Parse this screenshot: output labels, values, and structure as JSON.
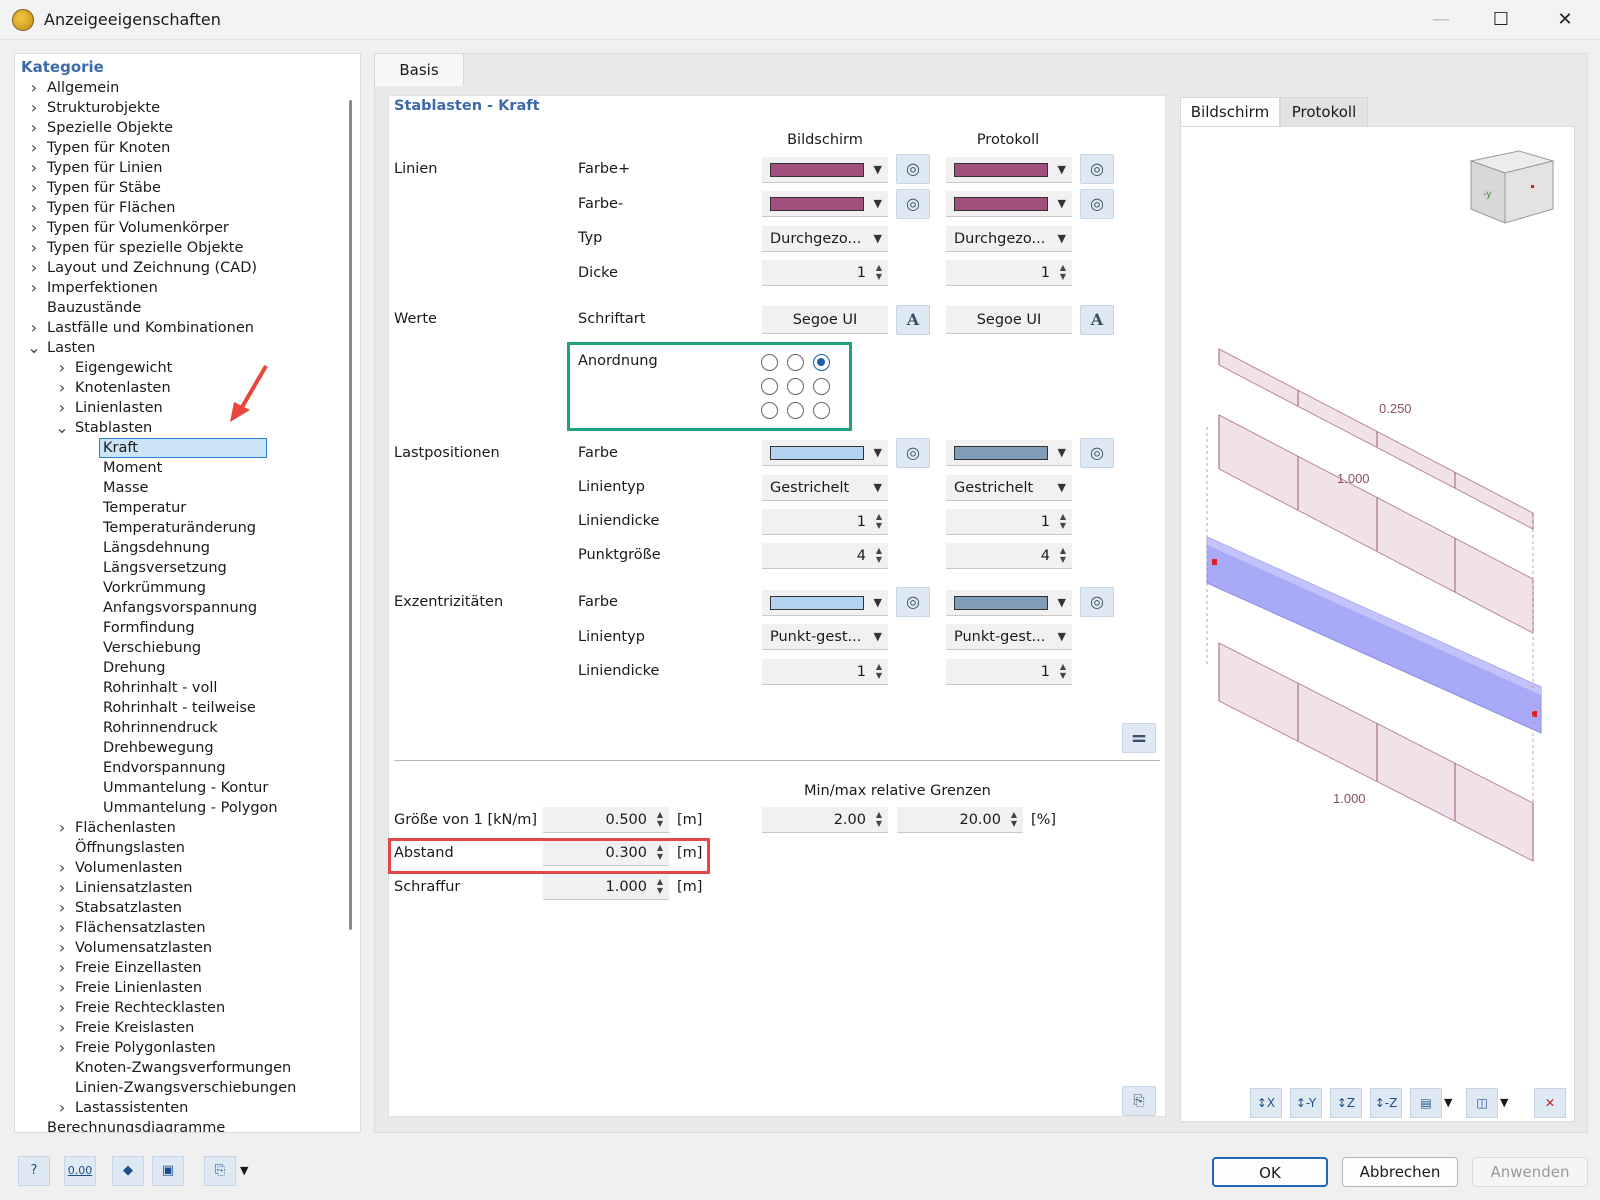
{
  "window": {
    "title": "Anzeigeeigenschaften"
  },
  "tree": {
    "header": "Kategorie",
    "items": [
      {
        "label": "Allgemein",
        "level": 0,
        "chev": ">"
      },
      {
        "label": "Strukturobjekte",
        "level": 0,
        "chev": ">"
      },
      {
        "label": "Spezielle Objekte",
        "level": 0,
        "chev": ">"
      },
      {
        "label": "Typen für Knoten",
        "level": 0,
        "chev": ">"
      },
      {
        "label": "Typen für Linien",
        "level": 0,
        "chev": ">"
      },
      {
        "label": "Typen für Stäbe",
        "level": 0,
        "chev": ">"
      },
      {
        "label": "Typen für Flächen",
        "level": 0,
        "chev": ">"
      },
      {
        "label": "Typen für Volumenkörper",
        "level": 0,
        "chev": ">"
      },
      {
        "label": "Typen für spezielle Objekte",
        "level": 0,
        "chev": ">"
      },
      {
        "label": "Layout und Zeichnung (CAD)",
        "level": 0,
        "chev": ">"
      },
      {
        "label": "Imperfektionen",
        "level": 0,
        "chev": ">"
      },
      {
        "label": "Bauzustände",
        "level": 0,
        "chev": ""
      },
      {
        "label": "Lastfälle und Kombinationen",
        "level": 0,
        "chev": ">"
      },
      {
        "label": "Lasten",
        "level": 0,
        "chev": "v"
      },
      {
        "label": "Eigengewicht",
        "level": 1,
        "chev": ">"
      },
      {
        "label": "Knotenlasten",
        "level": 1,
        "chev": ">"
      },
      {
        "label": "Linienlasten",
        "level": 1,
        "chev": ">"
      },
      {
        "label": "Stablasten",
        "level": 1,
        "chev": "v"
      },
      {
        "label": "Kraft",
        "level": 2,
        "chev": "",
        "selected": true
      },
      {
        "label": "Moment",
        "level": 2,
        "chev": ""
      },
      {
        "label": "Masse",
        "level": 2,
        "chev": ""
      },
      {
        "label": "Temperatur",
        "level": 2,
        "chev": ""
      },
      {
        "label": "Temperaturänderung",
        "level": 2,
        "chev": ""
      },
      {
        "label": "Längsdehnung",
        "level": 2,
        "chev": ""
      },
      {
        "label": "Längsversetzung",
        "level": 2,
        "chev": ""
      },
      {
        "label": "Vorkrümmung",
        "level": 2,
        "chev": ""
      },
      {
        "label": "Anfangsvorspannung",
        "level": 2,
        "chev": ""
      },
      {
        "label": "Formfindung",
        "level": 2,
        "chev": ""
      },
      {
        "label": "Verschiebung",
        "level": 2,
        "chev": ""
      },
      {
        "label": "Drehung",
        "level": 2,
        "chev": ""
      },
      {
        "label": "Rohrinhalt - voll",
        "level": 2,
        "chev": ""
      },
      {
        "label": "Rohrinhalt - teilweise",
        "level": 2,
        "chev": ""
      },
      {
        "label": "Rohrinnendruck",
        "level": 2,
        "chev": ""
      },
      {
        "label": "Drehbewegung",
        "level": 2,
        "chev": ""
      },
      {
        "label": "Endvorspannung",
        "level": 2,
        "chev": ""
      },
      {
        "label": "Ummantelung - Kontur",
        "level": 2,
        "chev": ""
      },
      {
        "label": "Ummantelung - Polygon",
        "level": 2,
        "chev": ""
      },
      {
        "label": "Flächenlasten",
        "level": 1,
        "chev": ">"
      },
      {
        "label": "Öffnungslasten",
        "level": 1,
        "chev": ""
      },
      {
        "label": "Volumenlasten",
        "level": 1,
        "chev": ">"
      },
      {
        "label": "Liniensatzlasten",
        "level": 1,
        "chev": ">"
      },
      {
        "label": "Stabsatzlasten",
        "level": 1,
        "chev": ">"
      },
      {
        "label": "Flächensatzlasten",
        "level": 1,
        "chev": ">"
      },
      {
        "label": "Volumensatzlasten",
        "level": 1,
        "chev": ">"
      },
      {
        "label": "Freie Einzellasten",
        "level": 1,
        "chev": ">"
      },
      {
        "label": "Freie Linienlasten",
        "level": 1,
        "chev": ">"
      },
      {
        "label": "Freie Rechtecklasten",
        "level": 1,
        "chev": ">"
      },
      {
        "label": "Freie Kreislasten",
        "level": 1,
        "chev": ">"
      },
      {
        "label": "Freie Polygonlasten",
        "level": 1,
        "chev": ">"
      },
      {
        "label": "Knoten-Zwangsverformungen",
        "level": 1,
        "chev": ""
      },
      {
        "label": "Linien-Zwangsverschiebungen",
        "level": 1,
        "chev": ""
      },
      {
        "label": "Lastassistenten",
        "level": 1,
        "chev": ">"
      },
      {
        "label": "Berechnungsdiagramme",
        "level": 0,
        "chev": ""
      }
    ]
  },
  "main": {
    "tab": "Basis",
    "section_title": "Stablasten - Kraft",
    "col_screen": "Bildschirm",
    "col_protocol": "Protokoll",
    "linien": {
      "group": "Linien",
      "farbe_plus": "Farbe+",
      "farbe_minus": "Farbe-",
      "typ": "Typ",
      "typ_screen": "Durchgezo...",
      "typ_protocol": "Durchgezo...",
      "dicke": "Dicke",
      "dicke_screen": "1",
      "dicke_protocol": "1",
      "color_plus": "#a34f7e",
      "color_minus": "#a34f7e"
    },
    "werte": {
      "group": "Werte",
      "schriftart": "Schriftart",
      "font_screen": "Segoe UI",
      "font_protocol": "Segoe UI",
      "anordnung": "Anordnung"
    },
    "lastpositionen": {
      "group": "Lastpositionen",
      "farbe": "Farbe",
      "linientyp": "Linientyp",
      "linientyp_screen": "Gestrichelt",
      "linientyp_protocol": "Gestrichelt",
      "liniendicke": "Liniendicke",
      "liniendicke_screen": "1",
      "liniendicke_protocol": "1",
      "punktgroesse": "Punktgröße",
      "punkt_screen": "4",
      "punkt_protocol": "4",
      "color_screen": "#b3d3f2",
      "color_protocol": "#7f9cb8"
    },
    "exzentrizitaeten": {
      "group": "Exzentrizitäten",
      "farbe": "Farbe",
      "linientyp": "Linientyp",
      "linientyp_screen": "Punkt-gest...",
      "linientyp_protocol": "Punkt-gest...",
      "liniendicke": "Liniendicke",
      "liniendicke_screen": "1",
      "liniendicke_protocol": "1",
      "color_screen": "#b3d3f2",
      "color_protocol": "#7f9cb8"
    },
    "bottom": {
      "minmax_label": "Min/max relative Grenzen",
      "groesse_label": "Größe von 1 [kN/m]",
      "groesse_value": "0.500",
      "groesse_unit": "[m]",
      "min_value": "2.00",
      "max_value": "20.00",
      "percent_unit": "[%]",
      "abstand_label": "Abstand",
      "abstand_value": "0.300",
      "abstand_unit": "[m]",
      "schraffur_label": "Schraffur",
      "schraffur_value": "1.000",
      "schraffur_unit": "[m]"
    }
  },
  "preview": {
    "tab_screen": "Bildschirm",
    "tab_protocol": "Protokoll",
    "label_top": "0.250",
    "label_mid": "1.000",
    "label_bottom": "1.000",
    "cube_label": "-y",
    "buttons": [
      "X",
      "-Y",
      "Z",
      "-Z"
    ]
  },
  "footer": {
    "ok": "OK",
    "cancel": "Abbrechen",
    "apply": "Anwenden",
    "zero_icon": "0.00"
  }
}
